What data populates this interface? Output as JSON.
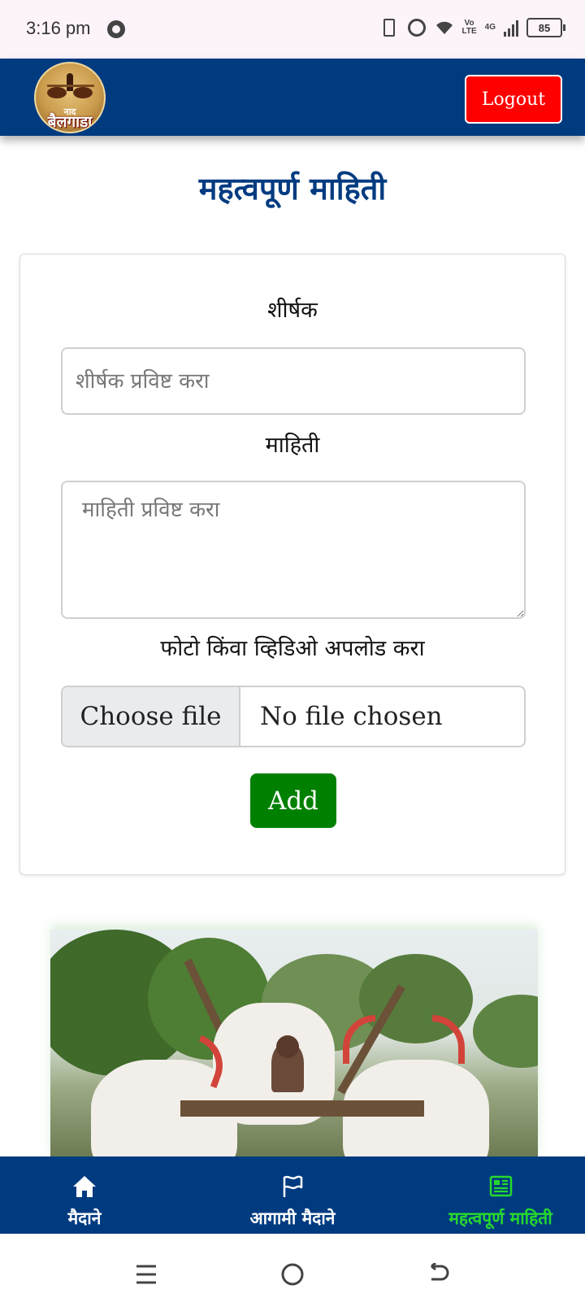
{
  "status_bar": {
    "time": "3:16 pm",
    "network_label": "Vo\nLTE",
    "network_type": "4G",
    "battery": "85"
  },
  "header": {
    "logo_text_top": "नाद",
    "logo_text_main": "बैलगाडा",
    "logout_label": "Logout"
  },
  "page": {
    "title": "महत्वपूर्ण माहिती"
  },
  "form": {
    "title_label": "शीर्षक",
    "title_placeholder": "शीर्षक प्रविष्ट करा",
    "title_value": "",
    "info_label": "माहिती",
    "info_placeholder": "माहिती प्रविष्ट करा",
    "info_value": "",
    "upload_label": "फोटो किंवा व्हिडिओ अपलोड करा",
    "choose_file_label": "Choose file",
    "file_status": "No file chosen",
    "add_label": "Add"
  },
  "bottom_nav": {
    "items": [
      {
        "label": "मैदाने",
        "icon": "home-icon"
      },
      {
        "label": "आगामी मैदाने",
        "icon": "flag-icon"
      },
      {
        "label": "महत्वपूर्ण माहिती",
        "icon": "newspaper-icon",
        "active": true
      }
    ]
  },
  "colors": {
    "header_bg": "#003b80",
    "logout_bg": "#ff0000",
    "add_bg": "#008000",
    "nav_active": "#27d82e"
  }
}
